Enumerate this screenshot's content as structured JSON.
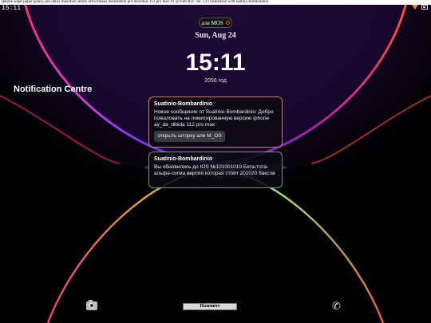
{
  "marquee": "Iphone super puper galaxy pro delux maximus ultimo ultra tonkus moderatum pro maximus 112 pro max 8T @Tom Ryz. ver. 123 calibration with suatino Bombardino",
  "statusbar": {
    "time": "15:11",
    "wifi_icon": "wifi-icon",
    "battery_icon": "battery-icon"
  },
  "pill": {
    "label": "али MOS"
  },
  "lockscreen": {
    "date": "Sun, Aug 24",
    "time": "15:11",
    "year": "2056 год"
  },
  "notification_centre": {
    "title": "Notification Centre"
  },
  "notifications": [
    {
      "app": "Suatinio-Bombardinio",
      "body": "Новое сообщение от Suatinio-Bombardinio: Добро пожаловать на лимитированную версию Iphone ay_da_dibida 112 pro max",
      "button": "открыть шторку али M_OS"
    },
    {
      "app": "Suatinio-Bombardinio",
      "body": "Вы обновились до IOS №101001010 Бета-тота-альфа-сигма версия которая стоит 202020 баксов"
    }
  ],
  "dock": {
    "camera_icon": "camera-icon",
    "home_label": "Нажмите",
    "phone_icon": "phone-icon"
  },
  "colors": {
    "arc_pink": "#e0308a",
    "arc_cyan": "#30c8e8",
    "arc_green": "#a0e070",
    "notification_border_1": "#d07a7a"
  }
}
